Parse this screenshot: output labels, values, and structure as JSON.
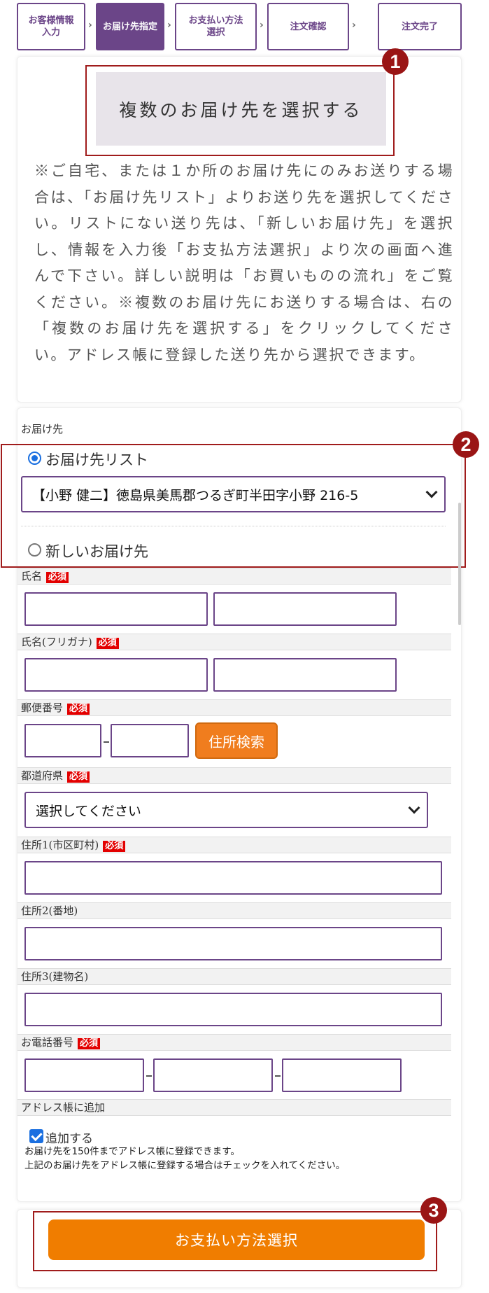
{
  "steps": [
    {
      "label": "お客様情報\n入力"
    },
    {
      "label": "お届け先指定"
    },
    {
      "label": "お支払い方法\n選択"
    },
    {
      "label": "注文確認"
    },
    {
      "label": "注文完了"
    }
  ],
  "step_separator": "›",
  "multi_destination_button": "複数のお届け先を選択する",
  "badges": {
    "one": "1",
    "two": "2",
    "three": "3"
  },
  "notice_text": "※ご自宅、または１か所のお届け先にのみお送りする場合は、「お届け先リスト」よりお送り先を選択してください。リストにない送り先は、「新しいお届け先」を選択し、情報を入力後「お支払方法選択」より次の画面へ進んで下さい。詳しい説明は「お買いものの流れ」をご覧ください。※複数のお届け先にお送りする場合は、右の「複数のお届け先を選択する」をクリックしてください。アドレス帳に登録した送り先から選択できます。",
  "form": {
    "section_label": "お届け先",
    "radio_list_label": "お届け先リスト",
    "address_select_value": "【小野 健二】徳島県美馬郡つるぎ町半田字小野 216-5",
    "radio_new_label": "新しいお届け先",
    "required_badge": "必須",
    "name_label": "氏名",
    "kana_label": "氏名(フリガナ)",
    "zip_label": "郵便番号",
    "zip_search_button": "住所検索",
    "pref_label": "都道府県",
    "pref_select_value": "選択してください",
    "addr1_label": "住所1(市区町村)",
    "addr2_label": "住所2(番地)",
    "addr3_label": "住所3(建物名)",
    "tel_label": "お電話番号",
    "addressbook_label": "アドレス帳に追加",
    "addressbook_check_label": "追加する",
    "addressbook_note1": "お届け先を150件までアドレス帳に登録できます。",
    "addressbook_note2": "上記のお届け先をアドレス帳に登録する場合はチェックを入れてください。"
  },
  "pay_button": "お支払い方法選択",
  "colors": {
    "accent": "#6b4588",
    "orange": "#f07d00",
    "highlight": "#a01c1c",
    "required": "#e30000",
    "radio": "#1a6fe0"
  }
}
